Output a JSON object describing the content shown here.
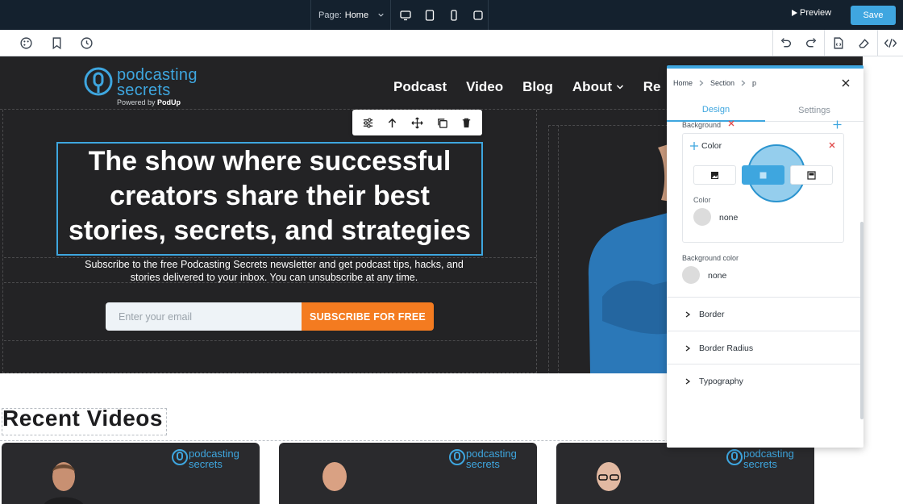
{
  "topbar": {
    "page_label": "Page:",
    "page_value": "Home",
    "preview_label": "Preview",
    "save_label": "Save"
  },
  "site": {
    "logo_word1": "podcasting",
    "logo_word2": "secrets",
    "powered_by": "Powered by",
    "powered_brand": "PodUp",
    "nav": [
      "Podcast",
      "Video",
      "Blog",
      "About",
      "Re"
    ],
    "headline": "The show where successful creators share their best stories, secrets, and strategies",
    "subtext": "Subscribe to the free Podcasting Secrets newsletter and get podcast tips, hacks, and stories delivered to your inbox. You can unsubscribe at any time.",
    "email_placeholder": "Enter your email",
    "subscribe_label": "SUBSCRIBE FOR FREE",
    "recent_title": "Recent Videos",
    "card_logo1": "podcasting",
    "card_logo2": "secrets"
  },
  "panel": {
    "crumbs": [
      "Home",
      "Section",
      "p"
    ],
    "tabs": {
      "design": "Design",
      "settings": "Settings"
    },
    "background_label": "Background",
    "color_title": "Color",
    "color_label": "Color",
    "color_value": "none",
    "bg_color_label": "Background color",
    "bg_color_value": "none",
    "accordions": [
      "Border",
      "Border Radius",
      "Typography"
    ]
  },
  "colors": {
    "accent": "#3ea6df",
    "topbar": "#14212e",
    "hero_bg": "#232325",
    "subscribe": "#f47b20"
  }
}
